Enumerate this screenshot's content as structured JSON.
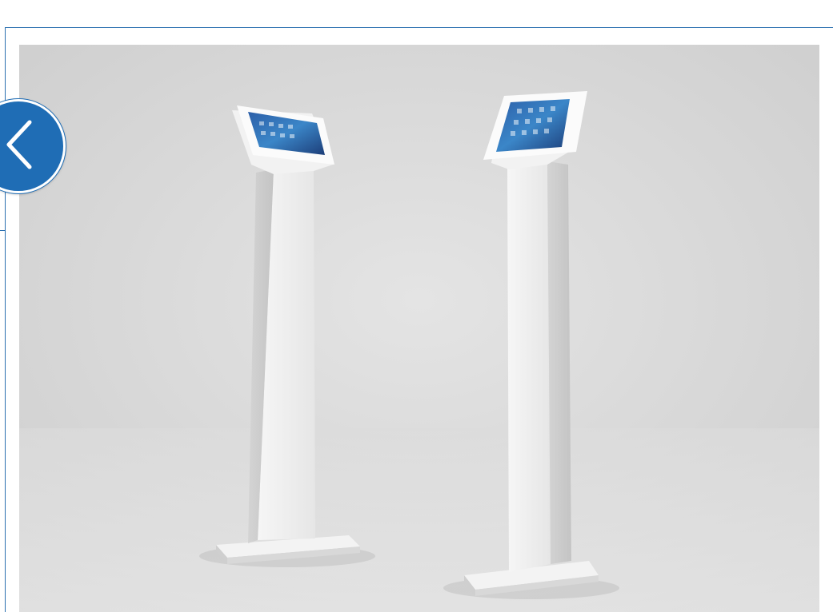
{
  "gallery": {
    "image_subject": "two-white-tablet-kiosk-floor-stands",
    "background_color": "#d9d9d9",
    "accent_color": "#1f6db5"
  },
  "controls": {
    "prev_icon": "chevron-left-icon"
  }
}
